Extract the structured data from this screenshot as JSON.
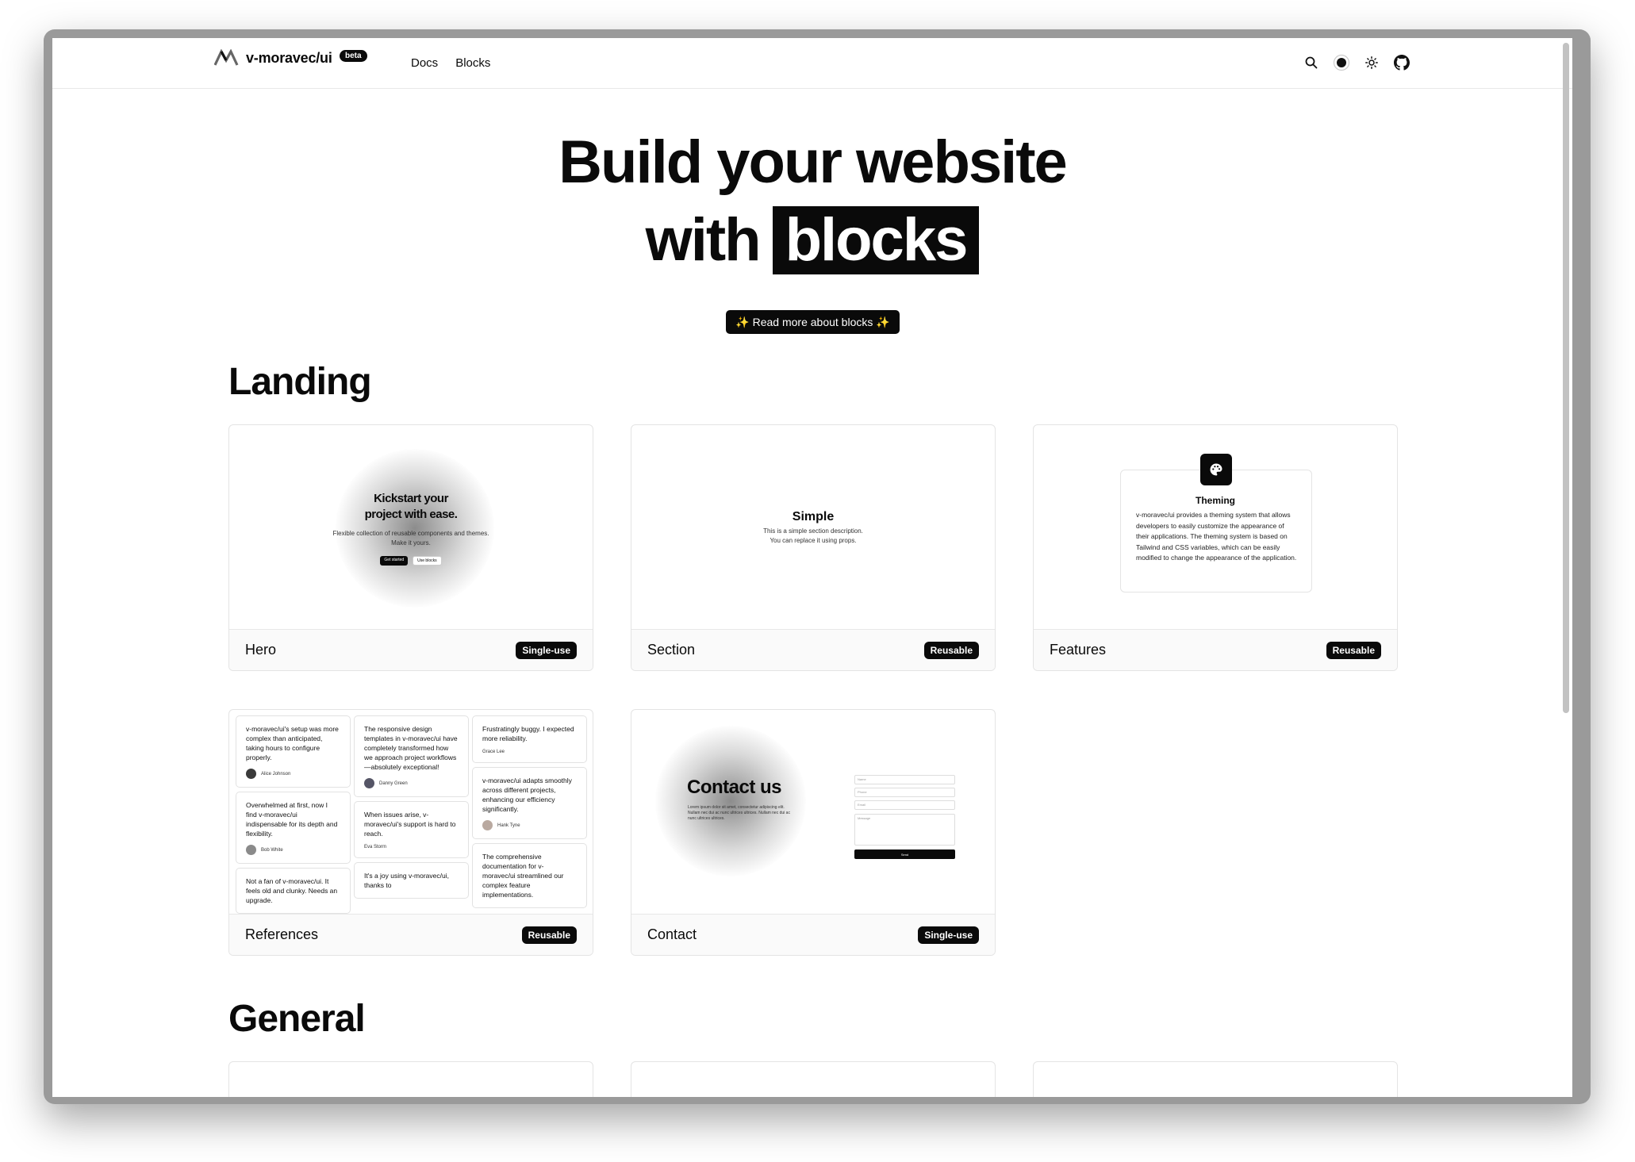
{
  "header": {
    "brand_name": "v-moravec/ui",
    "beta": "beta",
    "nav": [
      "Docs",
      "Blocks"
    ]
  },
  "hero": {
    "title_line1": "Build your website",
    "title_with": "with",
    "title_highlight": "blocks",
    "cta": "✨ Read more about blocks ✨"
  },
  "sections": {
    "landing": "Landing",
    "general": "General"
  },
  "cards": {
    "hero": {
      "name": "Hero",
      "badge": "Single-use"
    },
    "section": {
      "name": "Section",
      "badge": "Reusable"
    },
    "features": {
      "name": "Features",
      "badge": "Reusable"
    },
    "references": {
      "name": "References",
      "badge": "Reusable"
    },
    "contact": {
      "name": "Contact",
      "badge": "Single-use"
    }
  },
  "hero_preview": {
    "title_1": "Kickstart your",
    "title_2": "project with ease.",
    "sub_1": "Flexible collection of reusable components and themes.",
    "sub_2": "Make it yours.",
    "btn_primary": "Get started",
    "btn_secondary": "Use blocks"
  },
  "section_preview": {
    "title": "Simple",
    "desc_1": "This is a simple section description.",
    "desc_2": "You can replace it using props."
  },
  "features_preview": {
    "title": "Theming",
    "desc": "v-moravec/ui provides a theming system that allows developers to easily customize the appearance of their applications. The theming system is based on Tailwind and CSS variables, which can be easily modified to change the appearance of the application."
  },
  "references_preview": {
    "col1": [
      {
        "text": "v-moravec/ui's setup was more complex than anticipated, taking hours to configure properly.",
        "author": "Alice Johnson"
      },
      {
        "text": "Overwhelmed at first, now I find v-moravec/ui indispensable for its depth and flexibility.",
        "author": "Bob White"
      },
      {
        "text": "Not a fan of v-moravec/ui. It feels old and clunky. Needs an upgrade.",
        "author": ""
      }
    ],
    "col2": [
      {
        "text": "The responsive design templates in v-moravec/ui have completely transformed how we approach project workflows—absolutely exceptional!",
        "author": "Danny Green"
      },
      {
        "text": "When issues arise, v-moravec/ui's support is hard to reach.",
        "author": "Eva Storm"
      },
      {
        "text": "It's a joy using v-moravec/ui, thanks to",
        "author": ""
      }
    ],
    "col3": [
      {
        "text": "Frustratingly buggy. I expected more reliability.",
        "author": "Grace Lee"
      },
      {
        "text": "v-moravec/ui adapts smoothly across different projects, enhancing our efficiency significantly.",
        "author": "Hank Tyne"
      },
      {
        "text": "The comprehensive documentation for v-moravec/ui streamlined our complex feature implementations.",
        "author": ""
      }
    ]
  },
  "contact_preview": {
    "title": "Contact us",
    "sub": "Lorem ipsum dolor sit amet, consectetur adipiscing elit. Nullam nec dui ac nunc ultrices ultrices. Nullam nec dui ac nunc ultrices ultrices.",
    "f_name": "Name",
    "f_phone": "Phone",
    "f_email": "Email",
    "f_message": "Message",
    "send": "Send"
  }
}
